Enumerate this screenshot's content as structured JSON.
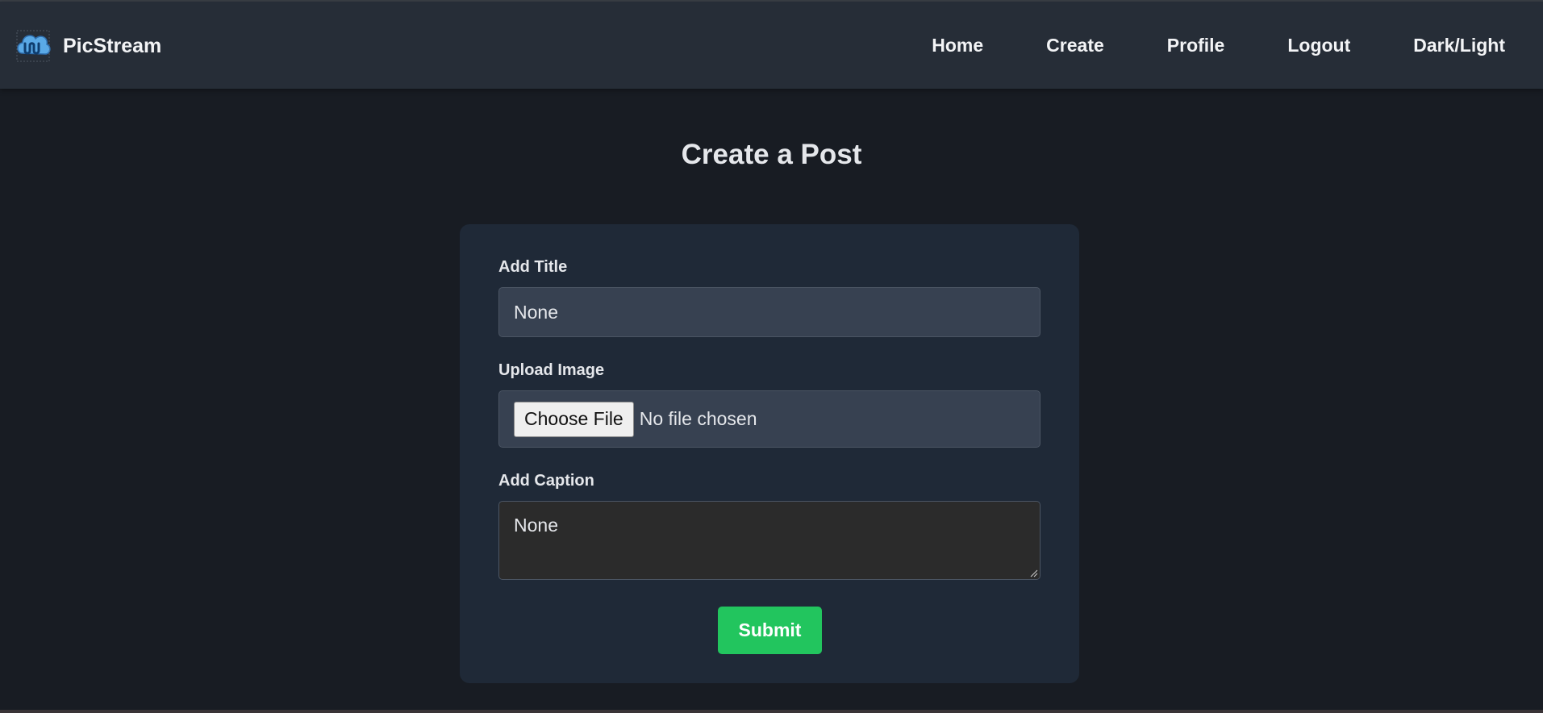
{
  "navbar": {
    "brand_name": "PicStream",
    "logo_icon": "picstream-cloud-logo",
    "links": [
      {
        "label": "Home"
      },
      {
        "label": "Create"
      },
      {
        "label": "Profile"
      },
      {
        "label": "Logout"
      },
      {
        "label": "Dark/Light"
      }
    ]
  },
  "page": {
    "title": "Create a Post"
  },
  "form": {
    "title_label": "Add Title",
    "title_value": "None",
    "image_label": "Upload Image",
    "choose_file_label": "Choose File",
    "file_status": "No file chosen",
    "caption_label": "Add Caption",
    "caption_value": "None",
    "submit_label": "Submit"
  },
  "colors": {
    "background": "#181c23",
    "navbar": "#262d37",
    "card": "#1f2937",
    "input": "#374151",
    "submit": "#22c55e"
  }
}
